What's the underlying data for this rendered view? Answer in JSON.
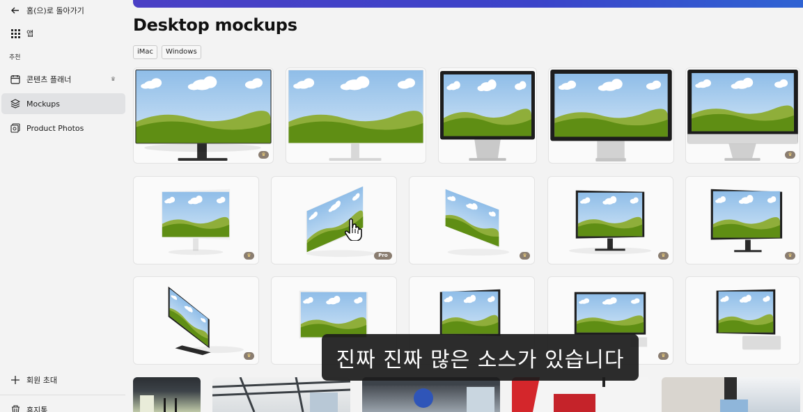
{
  "sidebar": {
    "back_label": "홈(으)로 돌아가기",
    "apps_label": "앱",
    "section_label": "추천",
    "items": [
      {
        "label": "콘텐츠 플래너",
        "icon": "calendar-icon"
      },
      {
        "label": "Mockups",
        "icon": "layers-icon"
      },
      {
        "label": "Product Photos",
        "icon": "photos-icon"
      }
    ],
    "invite_label": "회원 초대",
    "trash_label": "휴지통"
  },
  "main": {
    "title": "Desktop mockups",
    "chips": [
      "iMac",
      "Windows"
    ],
    "pro_label": "Pro"
  },
  "caption": "진짜 진짜 많은 소스가 있습니다",
  "colors": {
    "banner": "#3b43c9",
    "sky": "#a9cdee",
    "grass": "#6d9a1c",
    "active_nav": "#e1e2e4",
    "caption_bg": "#1c1c1c"
  }
}
